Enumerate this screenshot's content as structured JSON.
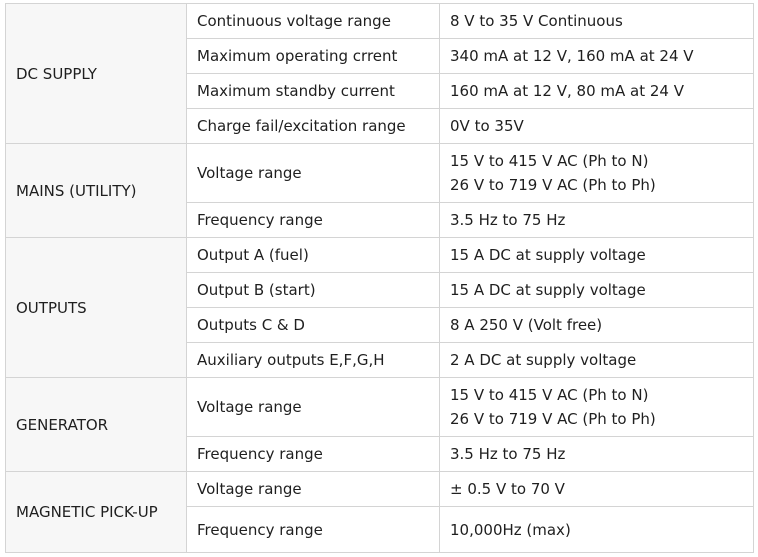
{
  "groups": [
    {
      "label": "DC SUPPLY",
      "rows": [
        {
          "param": "Continuous voltage range",
          "value": [
            "8 V to 35 V Continuous"
          ]
        },
        {
          "param": "Maximum operating crrent",
          "value": [
            "340 mA at 12 V, 160 mA at 24 V"
          ]
        },
        {
          "param": "Maximum standby current",
          "value": [
            "160 mA at 12 V, 80 mA at 24 V"
          ]
        },
        {
          "param": "Charge fail/excitation range",
          "value": [
            "0V to 35V"
          ]
        }
      ]
    },
    {
      "label": "MAINS (UTILITY)",
      "rows": [
        {
          "param": "Voltage range",
          "value": [
            "15 V to 415 V AC (Ph to N)",
            "26 V to 719 V AC (Ph to Ph)"
          ]
        },
        {
          "param": "Frequency range",
          "value": [
            "3.5 Hz to 75 Hz"
          ]
        }
      ]
    },
    {
      "label": "OUTPUTS",
      "rows": [
        {
          "param": "Output A (fuel)",
          "value": [
            "15 A DC at supply voltage"
          ]
        },
        {
          "param": "Output B (start)",
          "value": [
            "15 A DC at supply voltage"
          ]
        },
        {
          "param": "Outputs C & D",
          "value": [
            "8 A 250 V (Volt free)"
          ]
        },
        {
          "param": "Auxiliary outputs E,F,G,H",
          "value": [
            "2 A DC at supply voltage"
          ]
        }
      ]
    },
    {
      "label": "GENERATOR",
      "rows": [
        {
          "param": "Voltage range",
          "value": [
            "15 V to 415 V AC (Ph to N)",
            "26 V to 719 V AC (Ph to Ph)"
          ]
        },
        {
          "param": "Frequency range",
          "value": [
            "3.5 Hz to 75 Hz"
          ]
        }
      ]
    },
    {
      "label": "MAGNETIC PICK-UP",
      "rows": [
        {
          "param": "Voltage range",
          "value": [
            "± 0.5 V to 70 V"
          ]
        },
        {
          "param": "Frequency range",
          "value": [
            "10,000Hz (max)"
          ]
        }
      ]
    }
  ]
}
